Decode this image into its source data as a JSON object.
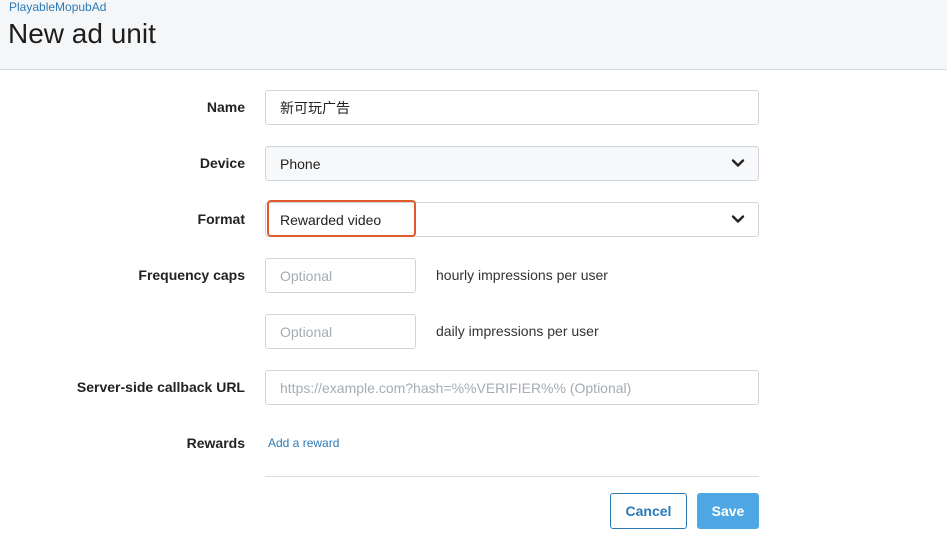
{
  "header": {
    "breadcrumb": "PlayableMopubAd",
    "title": "New ad unit"
  },
  "form": {
    "name": {
      "label": "Name",
      "value": "新可玩广告"
    },
    "device": {
      "label": "Device",
      "value": "Phone"
    },
    "format": {
      "label": "Format",
      "value": "Rewarded video"
    },
    "frequency_caps": {
      "label": "Frequency caps",
      "hourly": {
        "placeholder": "Optional",
        "suffix": "hourly impressions per user"
      },
      "daily": {
        "placeholder": "Optional",
        "suffix": "daily impressions per user"
      }
    },
    "callback_url": {
      "label": "Server-side callback URL",
      "placeholder": "https://example.com?hash=%%VERIFIER%% (Optional)"
    },
    "rewards": {
      "label": "Rewards",
      "add_link": "Add a reward"
    }
  },
  "actions": {
    "cancel": "Cancel",
    "save": "Save"
  },
  "colors": {
    "accent": "#2a7ab8",
    "primary_button": "#4ea7e3",
    "highlight": "#e35a2a"
  },
  "icons": {
    "select_indicator": "chevron-down-icon"
  }
}
